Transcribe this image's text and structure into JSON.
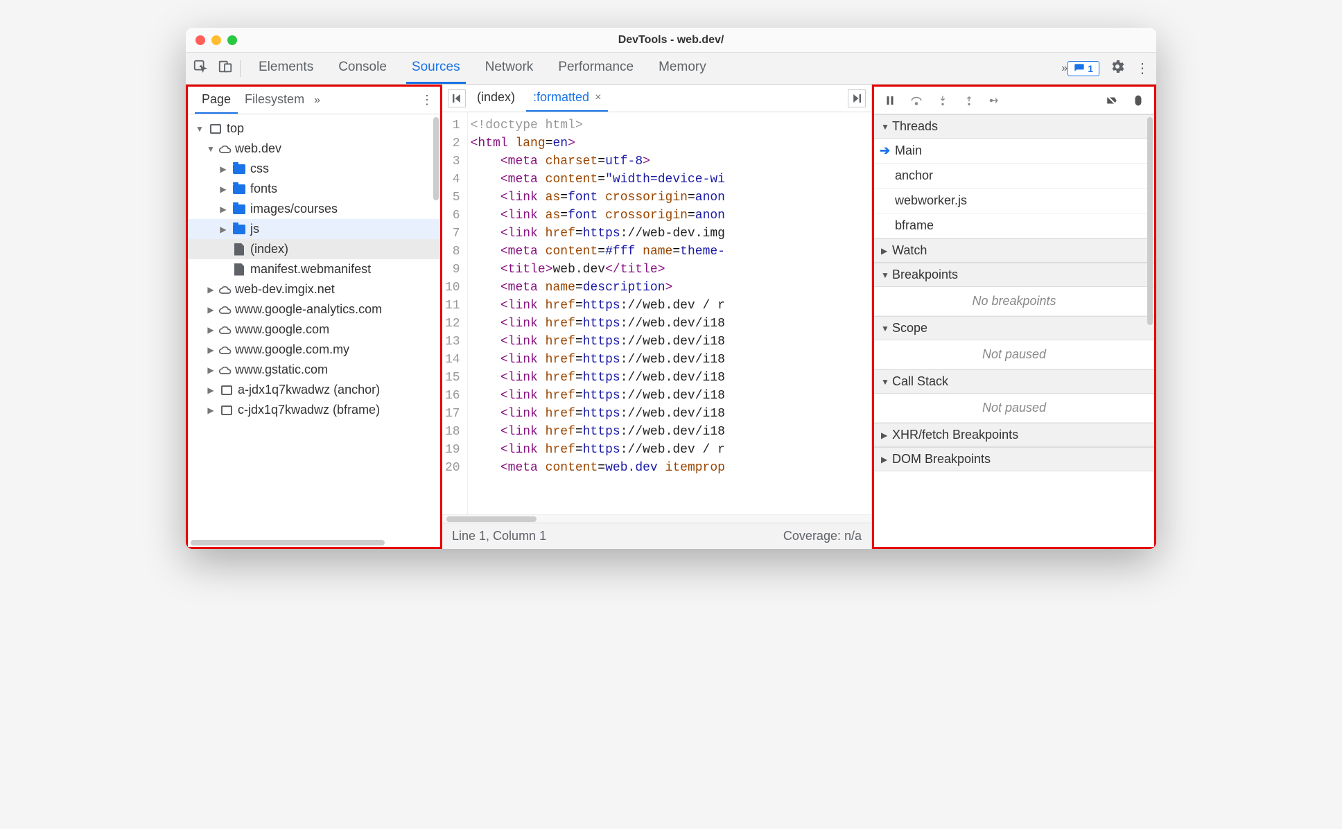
{
  "window_title": "DevTools - web.dev/",
  "toolbar": {
    "tabs": [
      "Elements",
      "Console",
      "Sources",
      "Network",
      "Performance",
      "Memory"
    ],
    "active_tab_index": 2,
    "overflow_label": "»",
    "message_count": "1"
  },
  "left": {
    "panel_tabs": [
      "Page",
      "Filesystem"
    ],
    "active_panel_tab": 0,
    "overflow_label": "»",
    "tree": [
      {
        "level": 0,
        "expand": "down",
        "icon": "frame",
        "label": "top"
      },
      {
        "level": 1,
        "expand": "down",
        "icon": "cloud",
        "label": "web.dev"
      },
      {
        "level": 2,
        "expand": "right",
        "icon": "folder",
        "label": "css"
      },
      {
        "level": 2,
        "expand": "right",
        "icon": "folder",
        "label": "fonts"
      },
      {
        "level": 2,
        "expand": "right",
        "icon": "folder",
        "label": "images/courses"
      },
      {
        "level": 2,
        "expand": "right",
        "icon": "folder",
        "label": "js",
        "hover": true
      },
      {
        "level": 2,
        "expand": "",
        "icon": "file",
        "label": "(index)",
        "sel": true
      },
      {
        "level": 2,
        "expand": "",
        "icon": "file",
        "label": "manifest.webmanifest"
      },
      {
        "level": 1,
        "expand": "right",
        "icon": "cloud",
        "label": "web-dev.imgix.net"
      },
      {
        "level": 1,
        "expand": "right",
        "icon": "cloud",
        "label": "www.google-analytics.com"
      },
      {
        "level": 1,
        "expand": "right",
        "icon": "cloud",
        "label": "www.google.com"
      },
      {
        "level": 1,
        "expand": "right",
        "icon": "cloud",
        "label": "www.google.com.my"
      },
      {
        "level": 1,
        "expand": "right",
        "icon": "cloud",
        "label": "www.gstatic.com"
      },
      {
        "level": 1,
        "expand": "right",
        "icon": "frame",
        "label": "a-jdx1q7kwadwz (anchor)"
      },
      {
        "level": 1,
        "expand": "right",
        "icon": "frame",
        "label": "c-jdx1q7kwadwz (bframe)"
      }
    ]
  },
  "center": {
    "file_tabs": [
      {
        "label": "(index)",
        "active": false
      },
      {
        "label": ":formatted",
        "active": true,
        "closable": true
      }
    ],
    "code_lines": [
      {
        "n": 1,
        "html": "<span class='tok-doc'>&lt;!doctype html&gt;</span>"
      },
      {
        "n": 2,
        "html": "<span class='tok-punct'>&lt;</span><span class='tok-tag'>html</span> <span class='tok-attr'>lang</span>=<span class='tok-val'>en</span><span class='tok-punct'>&gt;</span>"
      },
      {
        "n": 3,
        "html": "    <span class='tok-punct'>&lt;</span><span class='tok-tag'>meta</span> <span class='tok-attr'>charset</span>=<span class='tok-val'>utf-8</span><span class='tok-punct'>&gt;</span>"
      },
      {
        "n": 4,
        "html": "    <span class='tok-punct'>&lt;</span><span class='tok-tag'>meta</span> <span class='tok-attr'>content</span>=<span class='tok-val'>\"width=device-wi</span>"
      },
      {
        "n": 5,
        "html": "    <span class='tok-punct'>&lt;</span><span class='tok-tag'>link</span> <span class='tok-attr'>as</span>=<span class='tok-val'>font</span> <span class='tok-attr'>crossorigin</span>=<span class='tok-val'>anon</span>"
      },
      {
        "n": 6,
        "html": "    <span class='tok-punct'>&lt;</span><span class='tok-tag'>link</span> <span class='tok-attr'>as</span>=<span class='tok-val'>font</span> <span class='tok-attr'>crossorigin</span>=<span class='tok-val'>anon</span>"
      },
      {
        "n": 7,
        "html": "    <span class='tok-punct'>&lt;</span><span class='tok-tag'>link</span> <span class='tok-attr'>href</span>=<span class='tok-val'>https</span><span class='tok-text'>://web-dev.img</span>"
      },
      {
        "n": 8,
        "html": "    <span class='tok-punct'>&lt;</span><span class='tok-tag'>meta</span> <span class='tok-attr'>content</span>=<span class='tok-val'>#fff</span> <span class='tok-attr'>name</span>=<span class='tok-val'>theme-</span>"
      },
      {
        "n": 9,
        "html": "    <span class='tok-punct'>&lt;</span><span class='tok-tag'>title</span><span class='tok-punct'>&gt;</span><span class='tok-text'>web.dev</span><span class='tok-punct'>&lt;/</span><span class='tok-tag'>title</span><span class='tok-punct'>&gt;</span>"
      },
      {
        "n": 10,
        "html": "    <span class='tok-punct'>&lt;</span><span class='tok-tag'>meta</span> <span class='tok-attr'>name</span>=<span class='tok-val'>description</span><span class='tok-punct'>&gt;</span>"
      },
      {
        "n": 11,
        "html": "    <span class='tok-punct'>&lt;</span><span class='tok-tag'>link</span> <span class='tok-attr'>href</span>=<span class='tok-val'>https</span><span class='tok-text'>://web.dev / r</span>"
      },
      {
        "n": 12,
        "html": "    <span class='tok-punct'>&lt;</span><span class='tok-tag'>link</span> <span class='tok-attr'>href</span>=<span class='tok-val'>https</span><span class='tok-text'>://web.dev/i18</span>"
      },
      {
        "n": 13,
        "html": "    <span class='tok-punct'>&lt;</span><span class='tok-tag'>link</span> <span class='tok-attr'>href</span>=<span class='tok-val'>https</span><span class='tok-text'>://web.dev/i18</span>"
      },
      {
        "n": 14,
        "html": "    <span class='tok-punct'>&lt;</span><span class='tok-tag'>link</span> <span class='tok-attr'>href</span>=<span class='tok-val'>https</span><span class='tok-text'>://web.dev/i18</span>"
      },
      {
        "n": 15,
        "html": "    <span class='tok-punct'>&lt;</span><span class='tok-tag'>link</span> <span class='tok-attr'>href</span>=<span class='tok-val'>https</span><span class='tok-text'>://web.dev/i18</span>"
      },
      {
        "n": 16,
        "html": "    <span class='tok-punct'>&lt;</span><span class='tok-tag'>link</span> <span class='tok-attr'>href</span>=<span class='tok-val'>https</span><span class='tok-text'>://web.dev/i18</span>"
      },
      {
        "n": 17,
        "html": "    <span class='tok-punct'>&lt;</span><span class='tok-tag'>link</span> <span class='tok-attr'>href</span>=<span class='tok-val'>https</span><span class='tok-text'>://web.dev/i18</span>"
      },
      {
        "n": 18,
        "html": "    <span class='tok-punct'>&lt;</span><span class='tok-tag'>link</span> <span class='tok-attr'>href</span>=<span class='tok-val'>https</span><span class='tok-text'>://web.dev/i18</span>"
      },
      {
        "n": 19,
        "html": "    <span class='tok-punct'>&lt;</span><span class='tok-tag'>link</span> <span class='tok-attr'>href</span>=<span class='tok-val'>https</span><span class='tok-text'>://web.dev / r</span>"
      },
      {
        "n": 20,
        "html": "    <span class='tok-punct'>&lt;</span><span class='tok-tag'>meta</span> <span class='tok-attr'>content</span>=<span class='tok-val'>web.dev</span> <span class='tok-attr'>itemprop</span>"
      }
    ],
    "status_left": "Line 1, Column 1",
    "status_right": "Coverage: n/a"
  },
  "right": {
    "sections": [
      {
        "title": "Threads",
        "expanded": true,
        "items": [
          {
            "label": "Main",
            "active": true
          },
          {
            "label": "anchor"
          },
          {
            "label": "webworker.js"
          },
          {
            "label": "bframe"
          }
        ]
      },
      {
        "title": "Watch",
        "expanded": false
      },
      {
        "title": "Breakpoints",
        "expanded": true,
        "empty": "No breakpoints"
      },
      {
        "title": "Scope",
        "expanded": true,
        "empty": "Not paused"
      },
      {
        "title": "Call Stack",
        "expanded": true,
        "empty": "Not paused"
      },
      {
        "title": "XHR/fetch Breakpoints",
        "expanded": false
      },
      {
        "title": "DOM Breakpoints",
        "expanded": false
      }
    ]
  }
}
